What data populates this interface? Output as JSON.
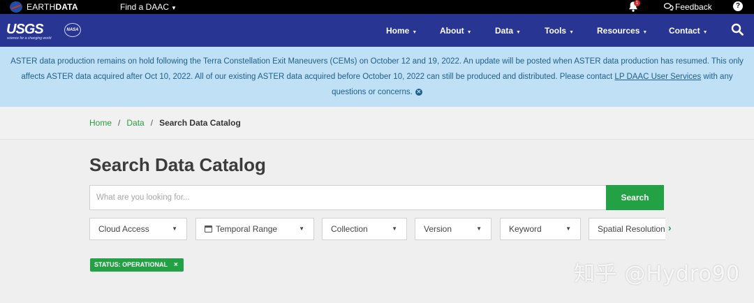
{
  "topbar": {
    "brand_prefix": "EARTH",
    "brand_suffix": "DATA",
    "find_daac": "Find a DAAC",
    "notification_count": "1",
    "feedback": "Feedback",
    "help": "?"
  },
  "nav": {
    "usgs": "USGS",
    "usgs_tagline": "science for a changing world",
    "nasa": "NASA",
    "menu": [
      "Home",
      "About",
      "Data",
      "Tools",
      "Resources",
      "Contact"
    ]
  },
  "alert": {
    "text_before_link": "ASTER data production remains on hold following the Terra Constellation Exit Maneuvers (CEMs) on October 12 and 19, 2022. An update will be posted when ASTER data production has resumed. This only affects ASTER data acquired after Oct 10, 2022. All of our existing ASTER data acquired before October 10, 2022 can still be produced and distributed. Please contact ",
    "link_text": "LP DAAC User Services",
    "text_after_link": " with any questions or concerns."
  },
  "breadcrumb": {
    "items": [
      "Home",
      "Data"
    ],
    "current": "Search Data Catalog"
  },
  "page": {
    "title": "Search Data Catalog"
  },
  "search": {
    "placeholder": "What are you looking for...",
    "button": "Search"
  },
  "facets": [
    "Cloud Access",
    "Temporal Range",
    "Collection",
    "Version",
    "Keyword",
    "Spatial Resolution ("
  ],
  "chips": [
    {
      "label": "STATUS: OPERATIONAL",
      "remove": "×"
    }
  ],
  "watermark": "知乎 @Hydro90",
  "colors": {
    "nav_bg": "#283593",
    "accent_green": "#22a244",
    "alert_bg": "#bfe0f5",
    "alert_text": "#1f5f8b"
  }
}
